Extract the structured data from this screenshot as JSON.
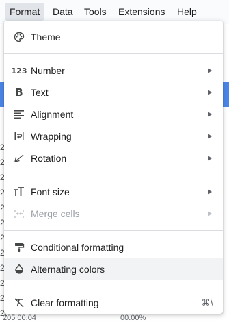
{
  "menubar": {
    "items": [
      "Format",
      "Data",
      "Tools",
      "Extensions",
      "Help"
    ]
  },
  "format_menu": {
    "theme": "Theme",
    "number": "Number",
    "text": "Text",
    "alignment": "Alignment",
    "wrapping": "Wrapping",
    "rotation": "Rotation",
    "font_size": "Font size",
    "merge_cells": "Merge cells",
    "conditional_formatting": "Conditional formatting",
    "alternating_colors": "Alternating colors",
    "clear_formatting": "Clear formatting",
    "clear_formatting_shortcut": "⌘\\",
    "number_icon_text": "123"
  },
  "sheet": {
    "row_prefix": "20",
    "bottom_left": "205 00.04",
    "bottom_right": "00.00%"
  },
  "colors": {
    "menubar_bg": "#f9fbfd",
    "active_menu_bg": "#e1e5ea",
    "header_blue": "#4a86e8",
    "hover_bg": "#f1f3f4",
    "icon": "#444746"
  }
}
